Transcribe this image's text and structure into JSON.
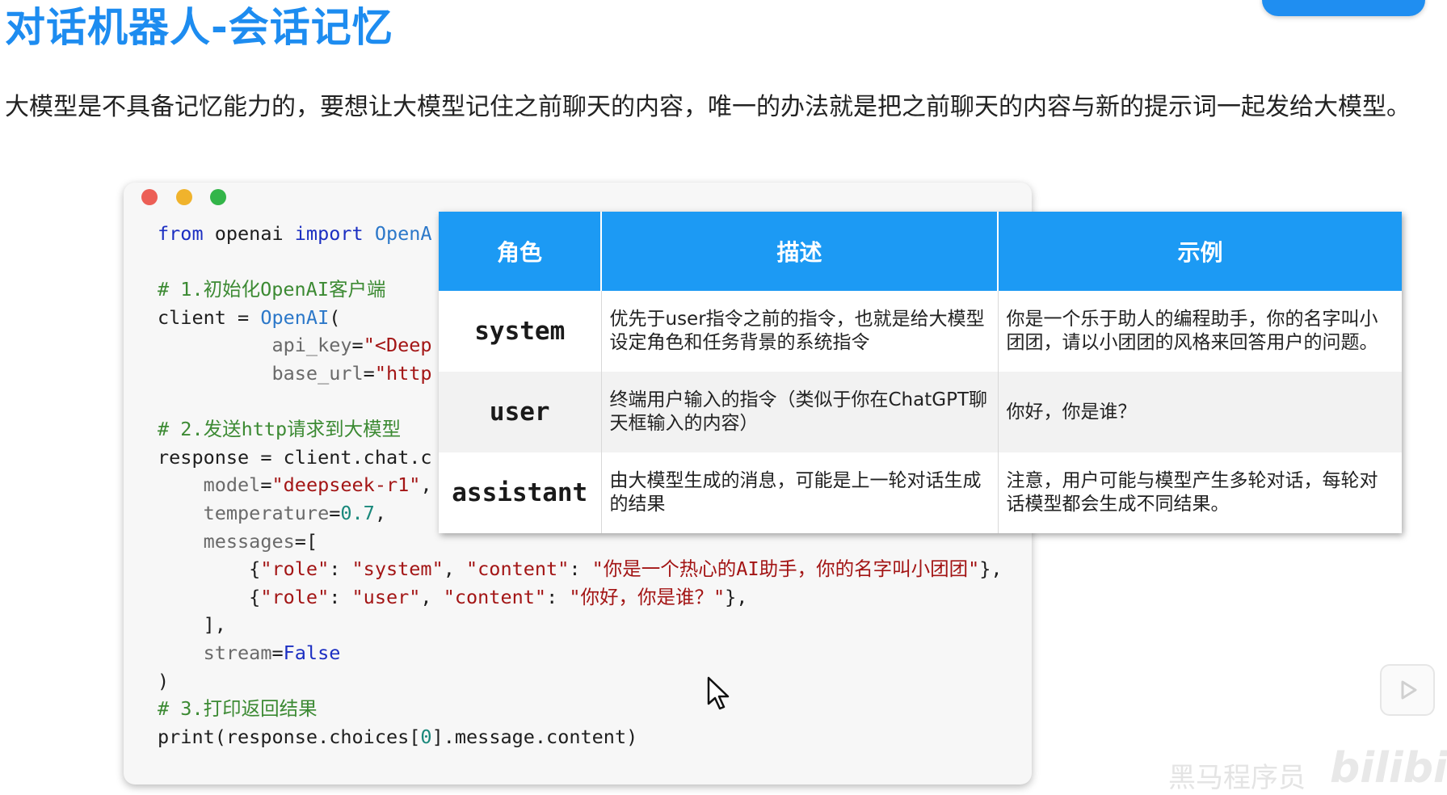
{
  "page": {
    "title": "对话机器人-会话记忆",
    "intro": "大模型是不具备记忆能力的，要想让大模型记住之前聊天的内容，唯一的办法就是把之前聊天的内容与新的提示词一起发给大模型。"
  },
  "code": {
    "line1_kw1": "from",
    "line1_mod": " openai ",
    "line1_kw2": "import",
    "line1_cls": " OpenA",
    "comment1": "# 1.初始化OpenAI客户端",
    "client_assign": "client = ",
    "client_cls": "OpenAI",
    "client_paren": "(",
    "api_key_name": "api_key",
    "api_key_val": "\"<Deep",
    "base_url_name": "base_url",
    "base_url_val": "\"http",
    "comment2": "# 2.发送http请求到大模型",
    "response_line": "response = client.chat.c",
    "model_name": "model",
    "model_val": "\"deepseek-r1\"",
    "temp_name": "temperature",
    "temp_val": "0.7",
    "messages_name": "messages",
    "messages_open": "[",
    "msg1_role_key": "\"role\"",
    "msg1_role_val": "\"system\"",
    "msg1_content_key": "\"content\"",
    "msg1_content_val": "\"你是一个热心的AI助手，你的名字叫小团团\"",
    "msg2_role_key": "\"role\"",
    "msg2_role_val": "\"user\"",
    "msg2_content_key": "\"content\"",
    "msg2_content_val": "\"你好，你是谁？\"",
    "messages_close": "],",
    "stream_name": "stream",
    "stream_val": "False",
    "close_paren": ")",
    "comment3": "# 3.打印返回结果",
    "print_pre": "print(response.choices[",
    "print_idx": "0",
    "print_post": "].message.content)"
  },
  "role_table": {
    "headers": [
      "角色",
      "描述",
      "示例"
    ],
    "rows": [
      {
        "role": "system",
        "desc": "优先于user指令之前的指令，也就是给大模型设定角色和任务背景的系统指令",
        "example": "你是一个乐于助人的编程助手，你的名字叫小团团，请以小团团的风格来回答用户的问题。"
      },
      {
        "role": "user",
        "desc": "终端用户输入的指令（类似于你在ChatGPT聊天框输入的内容）",
        "example": "你好，你是谁？"
      },
      {
        "role": "assistant",
        "desc": "由大模型生成的消息，可能是上一轮对话生成的结果",
        "example": "注意，用户可能与模型产生多轮对话，每轮对话模型都会生成不同结果。"
      }
    ]
  },
  "watermark": {
    "text": "黑马程序员",
    "logo": "bilibili"
  },
  "colors": {
    "title": "#1d8cf0",
    "table_header": "#1c9af4",
    "code_bg": "#f7f7f7"
  },
  "icons": [
    "traffic-light-close-icon",
    "traffic-light-minimize-icon",
    "traffic-light-zoom-icon",
    "mouse-cursor-icon",
    "play-icon"
  ]
}
